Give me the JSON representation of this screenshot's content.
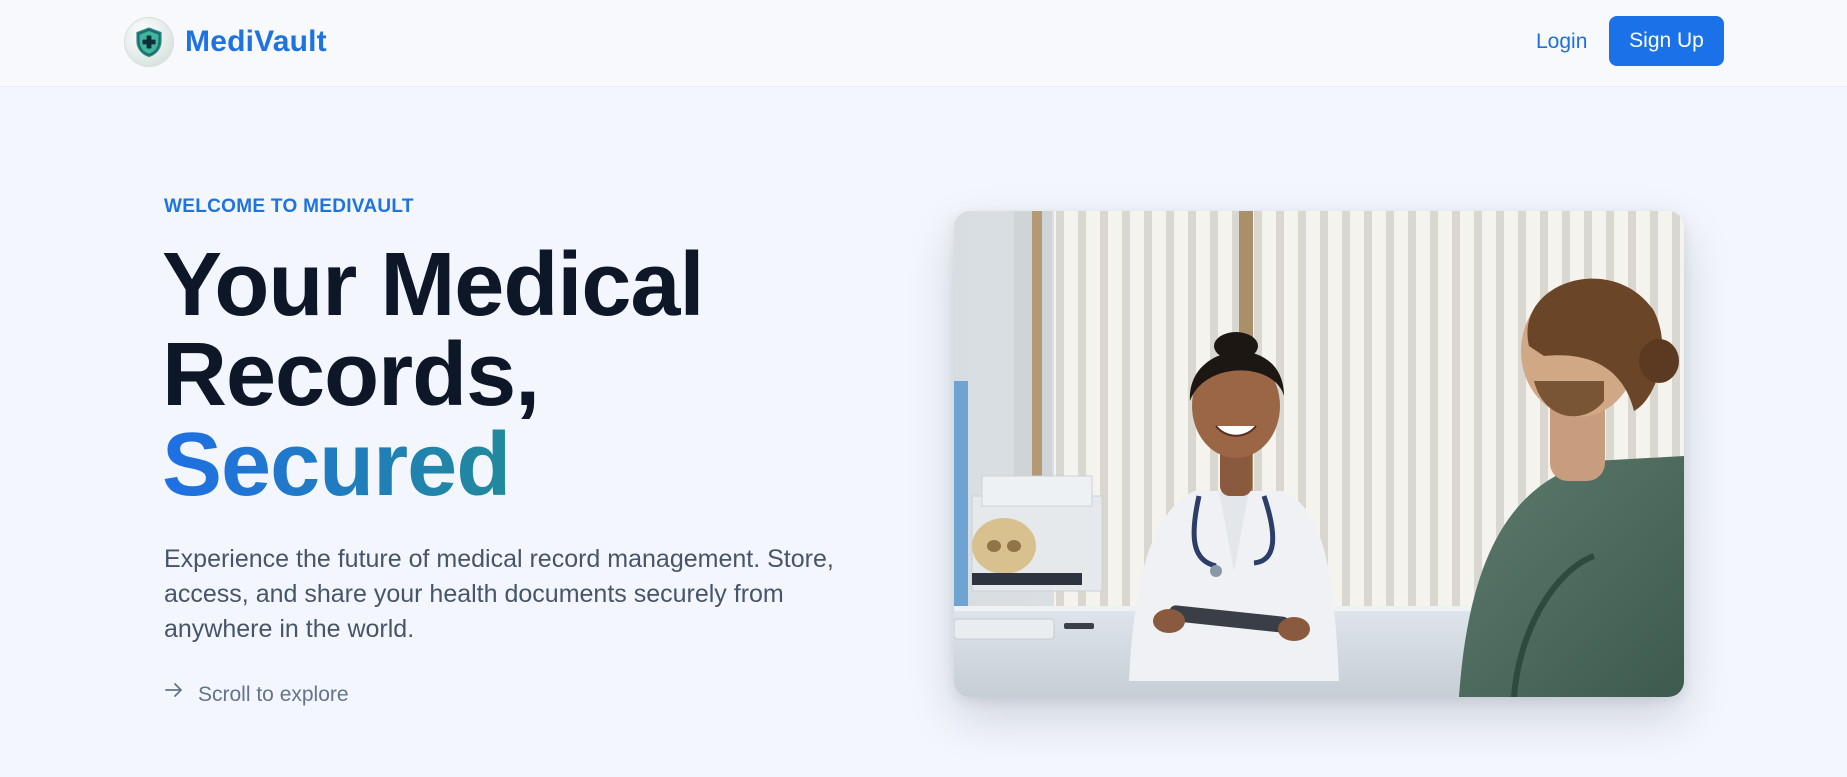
{
  "header": {
    "brand_name": "MediVault",
    "logo_icon": "shield-cross-icon",
    "login_label": "Login",
    "signup_label": "Sign Up"
  },
  "hero": {
    "eyebrow": "WELCOME TO MEDIVAULT",
    "title_line1": "Your Medical",
    "title_line2": "Records,",
    "title_accent": "Secured",
    "description": "Experience the future of medical record management. Store, access, and share your health documents securely from anywhere in the world.",
    "scroll_label": "Scroll to explore",
    "scroll_icon": "arrow-right-icon",
    "image_icon": "doctor-patient-photo"
  },
  "colors": {
    "brand": "#1f73e0",
    "button": "#1b72e8",
    "heading": "#0e1728",
    "accent_gradient_start": "#1f6fe5",
    "accent_gradient_end": "#23a05c",
    "body_text": "#475569"
  }
}
